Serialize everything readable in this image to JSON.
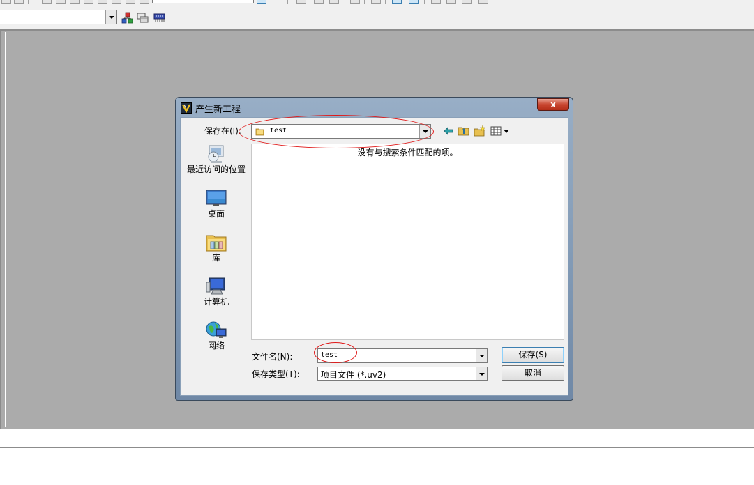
{
  "dialog": {
    "title": "产生新工程",
    "close_symbol": "x",
    "save_in": {
      "label": "保存在(I):",
      "value": "test"
    },
    "places": [
      {
        "label": "最近访问的位置",
        "icon": "recent-places-icon"
      },
      {
        "label": "桌面",
        "icon": "desktop-icon"
      },
      {
        "label": "库",
        "icon": "libraries-icon"
      },
      {
        "label": "计算机",
        "icon": "computer-icon"
      },
      {
        "label": "网络",
        "icon": "network-icon"
      }
    ],
    "file_list": {
      "empty_message": "没有与搜索条件匹配的项。"
    },
    "file_name": {
      "label": "文件名(N):",
      "value": "test"
    },
    "save_type": {
      "label": "保存类型(T):",
      "value": "项目文件 (*.uv2)"
    },
    "buttons": {
      "save": "保存(S)",
      "cancel": "取消"
    }
  },
  "toolbar": {
    "icons": [
      "add-file-icon",
      "window-layout-icon",
      "memory-view-icon"
    ]
  },
  "colors": {
    "workspace": "#ababab",
    "annotation": "#e01a1a",
    "title_bar": "#8aa2be",
    "close_button": "#c8452f"
  }
}
